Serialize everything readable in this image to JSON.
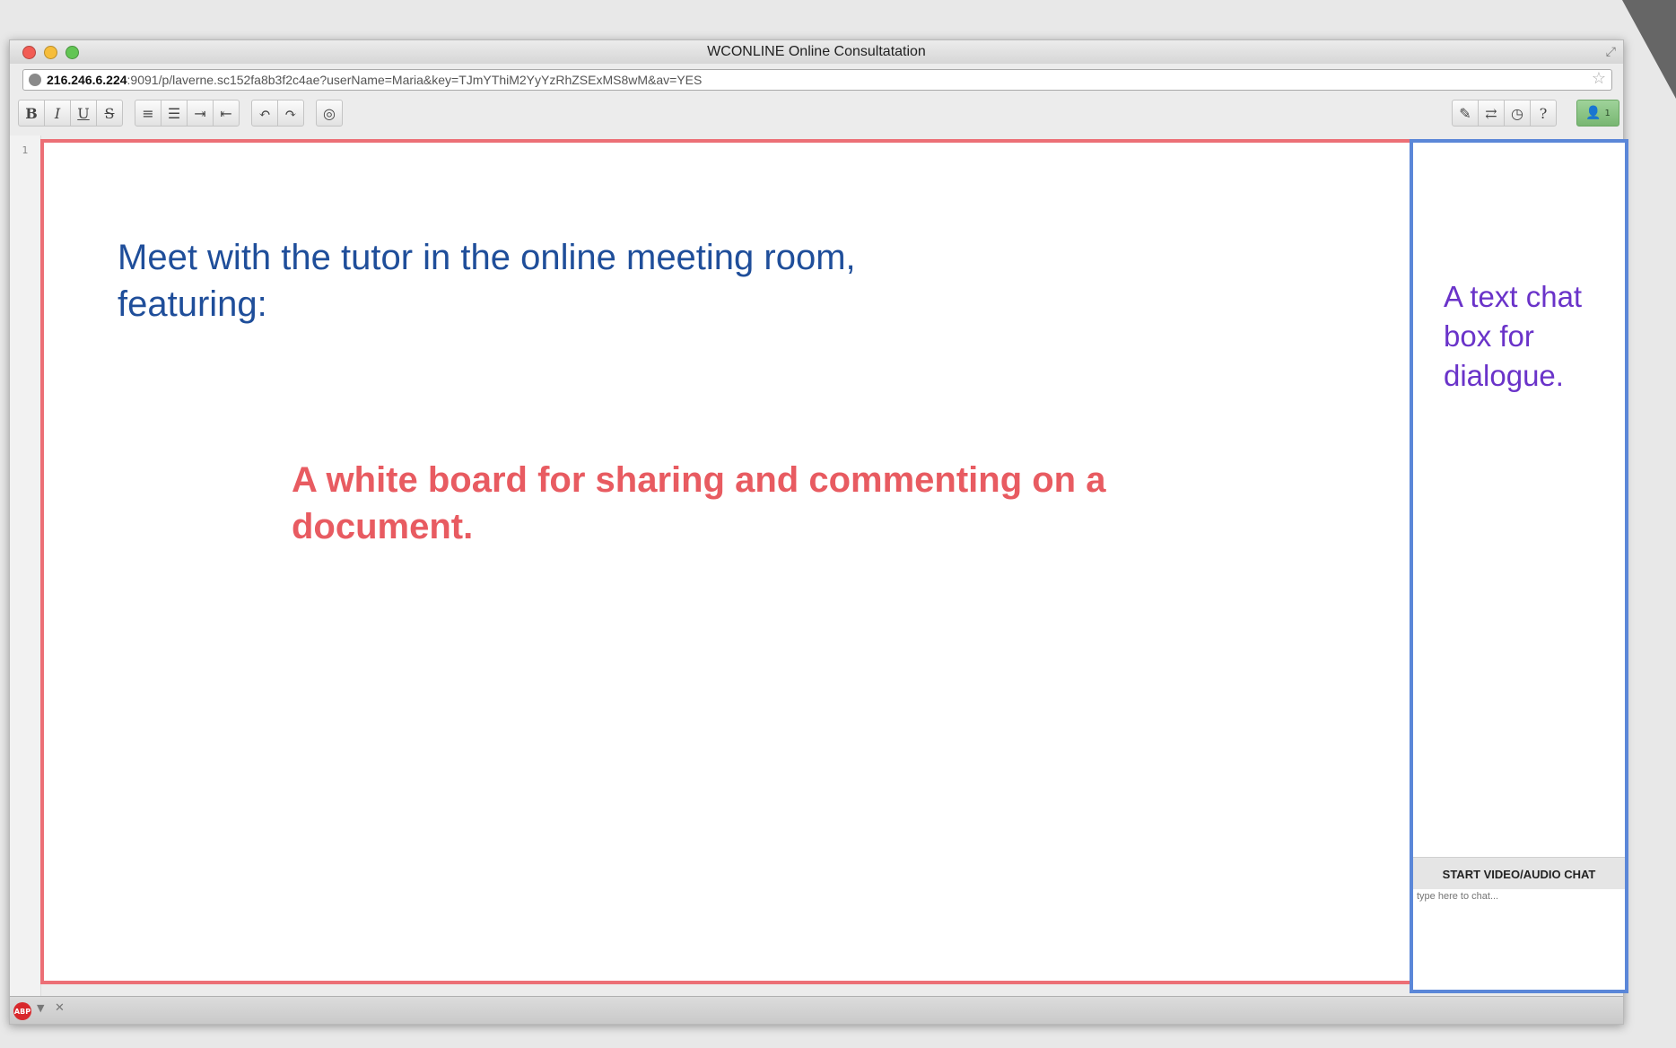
{
  "window": {
    "title": "WCONLINE Online Consultatation",
    "url_host": "216.246.6.224",
    "url_rest": ":9091/p/laverne.sc152fa8b3f2c4ae?userName=Maria&key=TJmYThiM2YyYzRhZSExMS8wM&av=YES"
  },
  "toolbar": {
    "bold": "B",
    "italic": "I",
    "underline": "U",
    "strike": "S",
    "ordered_list": "≡",
    "unordered_list": "☰",
    "indent": "⇥",
    "outdent": "⇤",
    "undo": "↶",
    "redo": "↷",
    "color": "◎",
    "pencil": "✎",
    "import_export": "⇄",
    "history": "◷",
    "help": "?",
    "user_count": "1"
  },
  "editor": {
    "line_number": "1",
    "heading": "Meet with the tutor in the online meeting room, featuring:",
    "whiteboard_note": "A white board for sharing and commenting on a document."
  },
  "chat": {
    "note": "A text chat box for dialogue.",
    "video_button": "START VIDEO/AUDIO CHAT",
    "input_placeholder": "type here to chat..."
  },
  "statusbar": {
    "abp_label": "ABP"
  }
}
